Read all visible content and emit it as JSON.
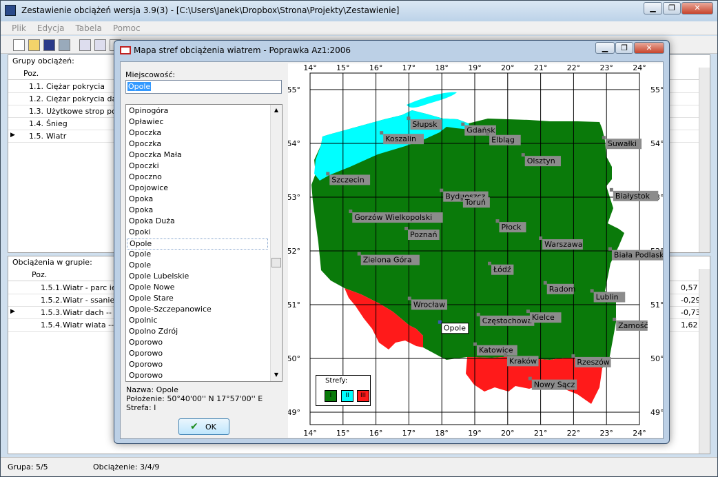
{
  "app": {
    "title": "Zestawienie obciążeń wersja 3.9(3) - [C:\\Users\\Janek\\Dropbox\\Strona\\Projekty\\Zestawienie]",
    "window_buttons": {
      "minimize": "▁",
      "restore": "❐",
      "close": "✕"
    },
    "menu": [
      "Plik",
      "Edycja",
      "Tabela",
      "Pomoc"
    ]
  },
  "groups": {
    "header": "Grupy obciążeń:",
    "col_poz": "Poz.",
    "rows": [
      {
        "poz": "1.1.",
        "name": "Ciężar pokrycia",
        "current": false
      },
      {
        "poz": "1.2.",
        "name": "Ciężar pokrycia daszk",
        "current": false
      },
      {
        "poz": "1.3.",
        "name": "Użytkowe strop podw",
        "current": false
      },
      {
        "poz": "1.4.",
        "name": "Śnieg",
        "current": false
      },
      {
        "poz": "1.5.",
        "name": "Wiatr",
        "current": true
      }
    ]
  },
  "loads": {
    "header": "Obciążenia w grupie:",
    "col_poz": "Poz.",
    "rows": [
      {
        "poz": "1.5.1.",
        "name": "Wiatr - parc ie",
        "value": "0,57",
        "current": false
      },
      {
        "poz": "1.5.2.",
        "name": "Wiatr - ssanie",
        "value": "-0,29",
        "current": false
      },
      {
        "poz": "1.5.3.",
        "name": "Wiatr dach -- ss",
        "value": "-0,73",
        "current": true
      },
      {
        "poz": "1.5.4.",
        "name": "Wiatr wiata -- pa",
        "value": "1,62",
        "current": false
      }
    ]
  },
  "status": {
    "group": "Grupa: 5/5",
    "load": "Obciążenie: 3/4/9"
  },
  "dialog": {
    "title": "Mapa stref obciążenia wiatrem - Poprawka Az1:2006",
    "buttons": {
      "minimize": "▁",
      "restore": "❐",
      "close": "✕"
    },
    "locality_label": "Miejscowość:",
    "locality_value": "Opole",
    "list": [
      "Opinogóra",
      "Opławiec",
      "Opoczka",
      "Opoczka",
      "Opoczka Mała",
      "Opoczki",
      "Opoczno",
      "Opojowice",
      "Opoka",
      "Opoka",
      "Opoka Duża",
      "Opoki",
      "Opole",
      "Opole",
      "Opole",
      "Opole Lubelskie",
      "Opole Nowe",
      "Opole Stare",
      "Opole-Szczepanowice",
      "Opolnic",
      "Opolno Zdrój",
      "Oporowo",
      "Oporowo",
      "Oporowo",
      "Oporowo"
    ],
    "list_selected_index": 12,
    "info_name": "Nazwa: Opole",
    "info_position": "Położenie: 50°40'00'' N 17°57'00'' E",
    "info_zone": "Strefa: I",
    "ok_label": "OK"
  },
  "map": {
    "lon_labels": [
      "14°",
      "15°",
      "16°",
      "17°",
      "18°",
      "19°",
      "20°",
      "21°",
      "22°",
      "23°",
      "24°"
    ],
    "lat_labels": [
      "55°",
      "54°",
      "53°",
      "52°",
      "51°",
      "50°",
      "49°"
    ],
    "legend_title": "Strefy:",
    "zones": [
      {
        "label": "I",
        "color": "#0a7a0a"
      },
      {
        "label": "II",
        "color": "#00ffff"
      },
      {
        "label": "III",
        "color": "#ff1a1a"
      }
    ],
    "cities": [
      {
        "name": "Słupsk",
        "lon": 17.0,
        "lat": 54.46
      },
      {
        "name": "Gdańsk",
        "lon": 18.65,
        "lat": 54.35
      },
      {
        "name": "Koszalin",
        "lon": 16.18,
        "lat": 54.19
      },
      {
        "name": "Elbląg",
        "lon": 19.4,
        "lat": 54.17
      },
      {
        "name": "Suwałki",
        "lon": 22.93,
        "lat": 54.1
      },
      {
        "name": "Olsztyn",
        "lon": 20.48,
        "lat": 53.78
      },
      {
        "name": "Szczecin",
        "lon": 14.55,
        "lat": 53.43
      },
      {
        "name": "Bydgoszcz",
        "lon": 18.0,
        "lat": 53.12
      },
      {
        "name": "Toruń",
        "lon": 18.6,
        "lat": 53.01
      },
      {
        "name": "Białystok",
        "lon": 23.16,
        "lat": 53.13
      },
      {
        "name": "Gorzów Wielkopolski",
        "lon": 15.24,
        "lat": 52.73
      },
      {
        "name": "Poznań",
        "lon": 16.93,
        "lat": 52.41
      },
      {
        "name": "Płock",
        "lon": 19.7,
        "lat": 52.55
      },
      {
        "name": "Warszawa",
        "lon": 21.01,
        "lat": 52.23
      },
      {
        "name": "Biała Podlaska",
        "lon": 23.12,
        "lat": 52.03
      },
      {
        "name": "Zielona Góra",
        "lon": 15.5,
        "lat": 51.94
      },
      {
        "name": "Łódź",
        "lon": 19.46,
        "lat": 51.76
      },
      {
        "name": "Radom",
        "lon": 21.15,
        "lat": 51.4
      },
      {
        "name": "Lublin",
        "lon": 22.57,
        "lat": 51.25
      },
      {
        "name": "Wrocław",
        "lon": 17.03,
        "lat": 51.11
      },
      {
        "name": "Częstochowa",
        "lon": 19.12,
        "lat": 50.81
      },
      {
        "name": "Kielce",
        "lon": 20.63,
        "lat": 50.87
      },
      {
        "name": "Zamość",
        "lon": 23.25,
        "lat": 50.72
      },
      {
        "name": "Opole",
        "lon": 17.95,
        "lat": 50.67
      },
      {
        "name": "Katowice",
        "lon": 19.02,
        "lat": 50.26
      },
      {
        "name": "Kraków",
        "lon": 19.94,
        "lat": 50.06
      },
      {
        "name": "Rzeszów",
        "lon": 22.0,
        "lat": 50.04
      },
      {
        "name": "Nowy Sącz",
        "lon": 20.69,
        "lat": 49.62
      }
    ],
    "selected_city": "Opole"
  }
}
